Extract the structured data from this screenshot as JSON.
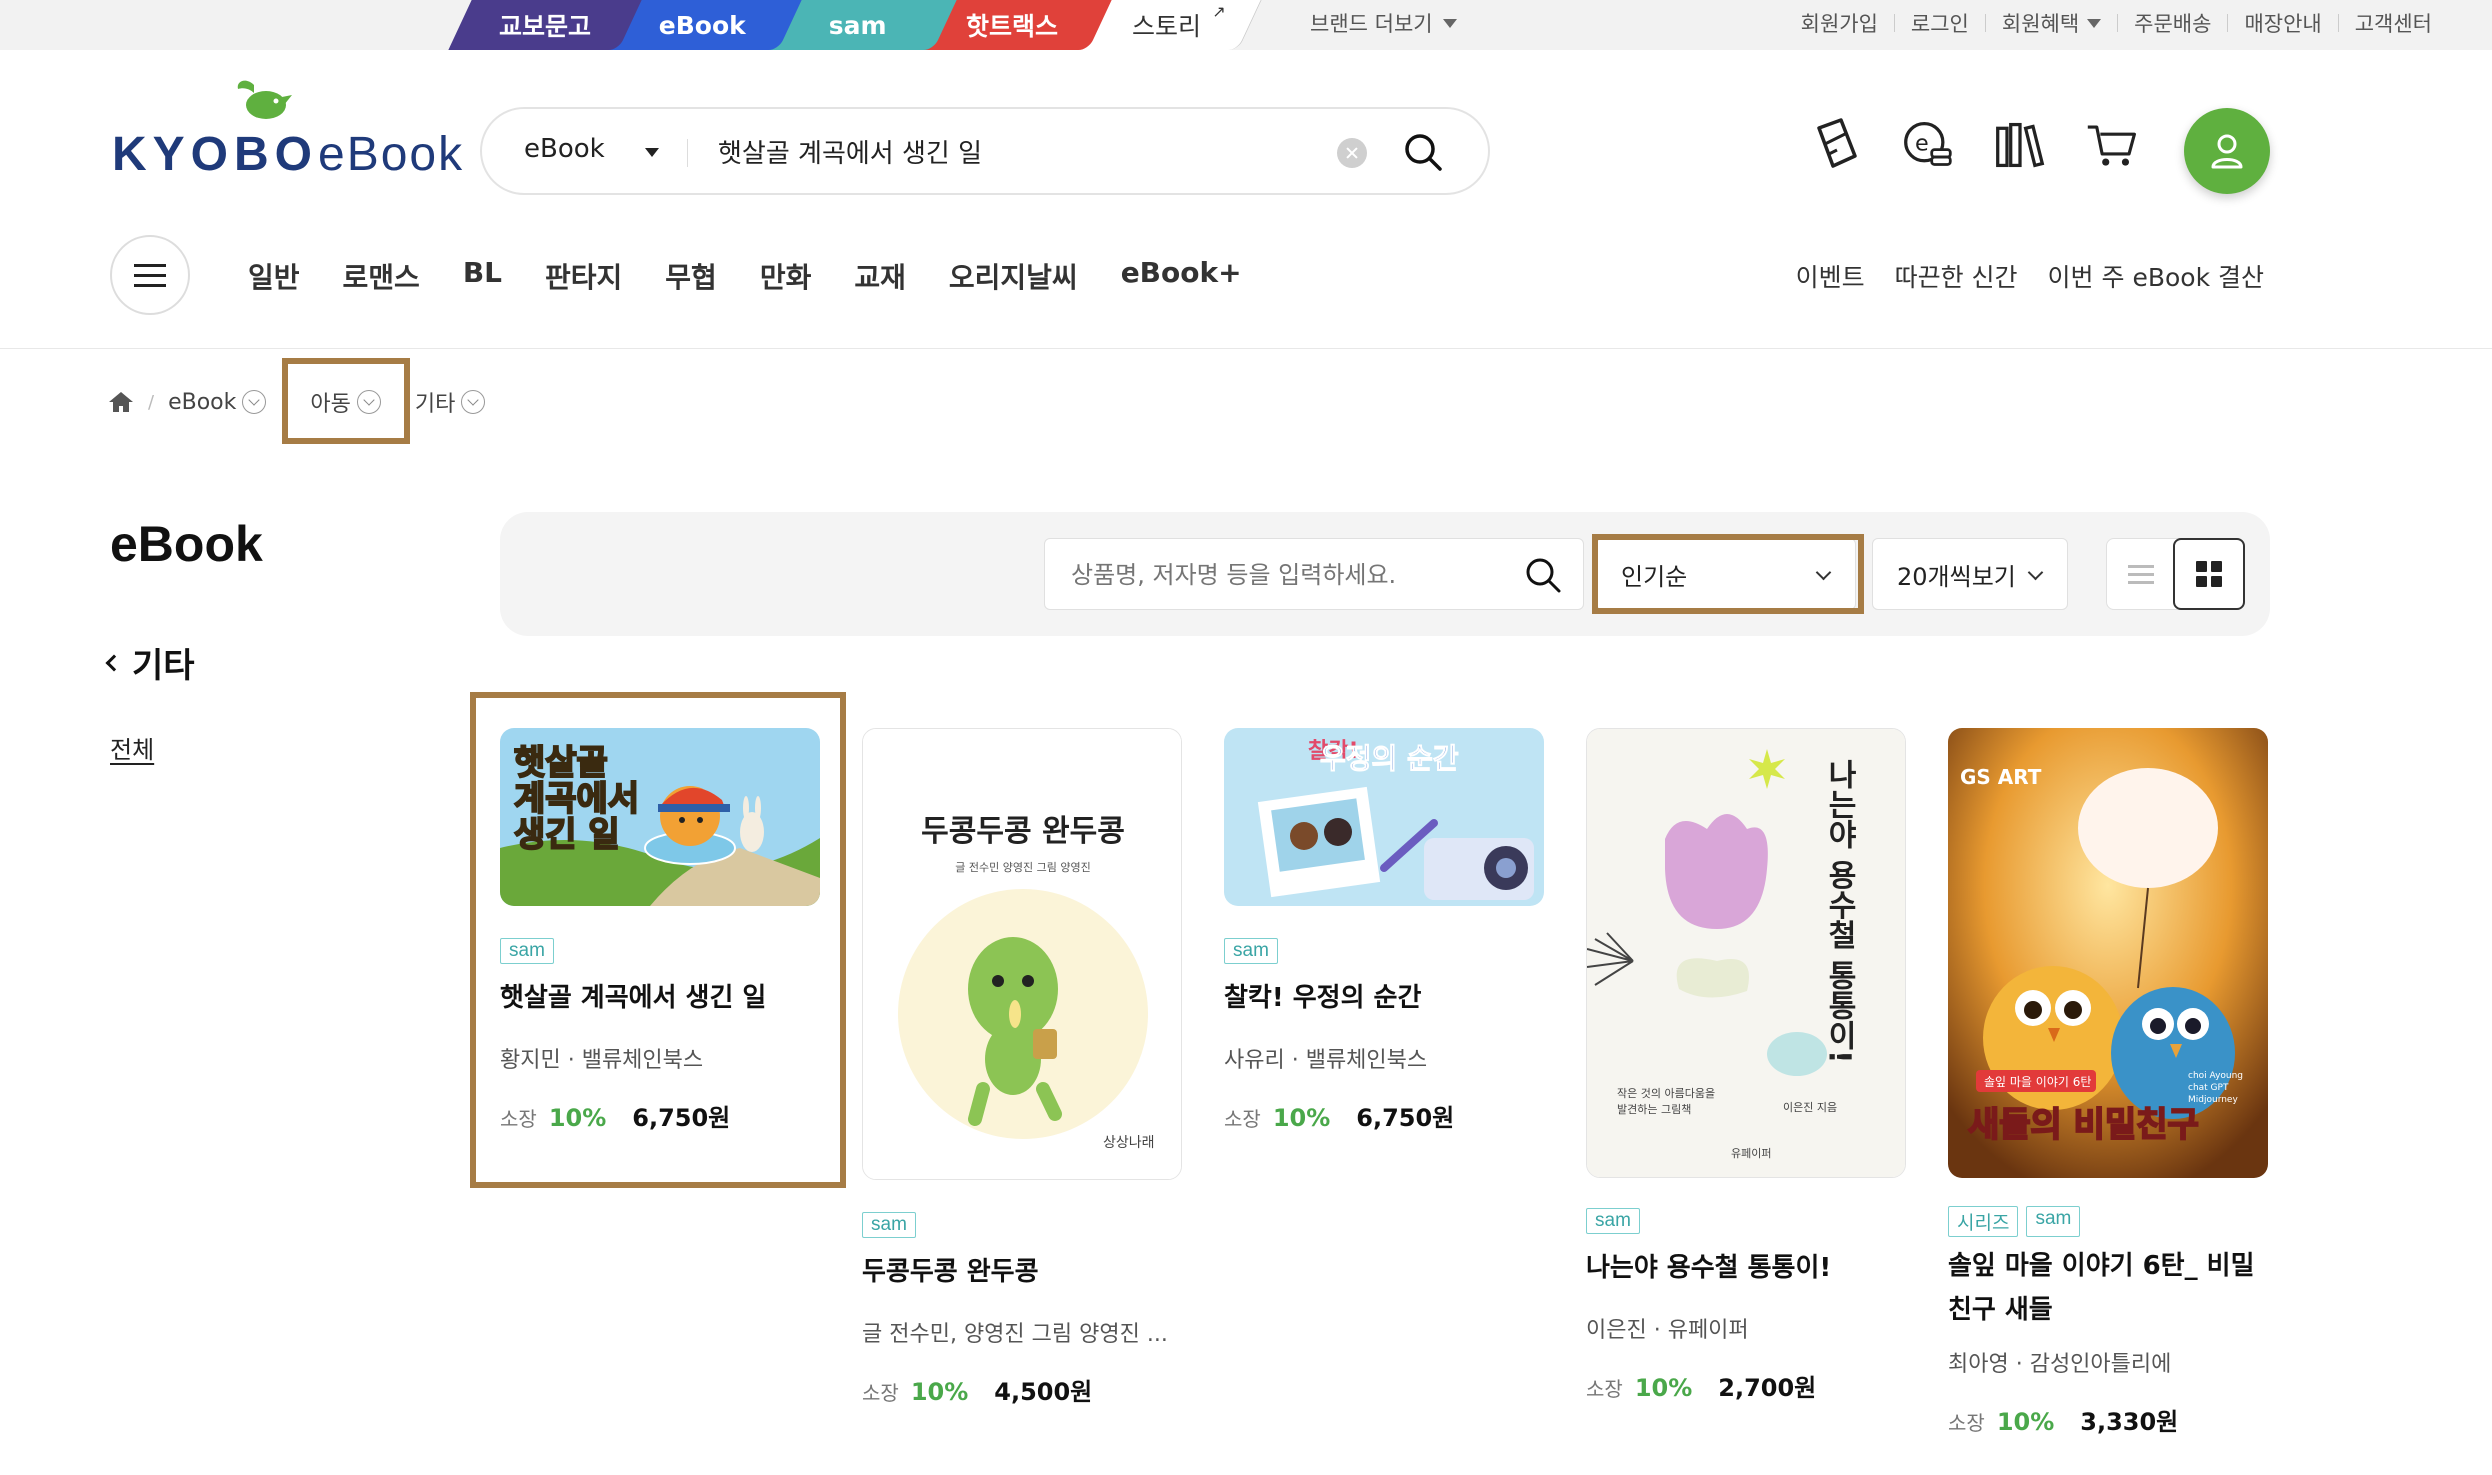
{
  "brand_tabs": [
    "교보문고",
    "eBook",
    "sam",
    "핫트랙스",
    "스토리"
  ],
  "brand_more": "브랜드 더보기",
  "util_links": [
    "회원가입",
    "로그인",
    "회원혜택",
    "주문배송",
    "매장안내",
    "고객센터"
  ],
  "logo": {
    "kyobo": "KYOBO",
    "ebook": "eBook"
  },
  "search": {
    "category": "eBook",
    "query": "햇살골 계곡에서 생긴 일"
  },
  "header_icons": [
    "ticket-icon",
    "ecash-icon",
    "library-icon",
    "cart-icon",
    "user-icon"
  ],
  "category_nav": [
    "일반",
    "로맨스",
    "BL",
    "판타지",
    "무협",
    "만화",
    "교재",
    "오리지날씨",
    "eBook+"
  ],
  "sub_nav": [
    "이벤트",
    "따끈한 신간",
    "이번 주 eBook 결산"
  ],
  "breadcrumb": {
    "level1": "eBook",
    "level2": "아동",
    "level3": "기타"
  },
  "sidebar": {
    "title": "eBook",
    "back_label": "기타",
    "all_link": "전체"
  },
  "filter": {
    "search_placeholder": "상품명, 저자명 등을 입력하세요.",
    "sort": "인기순",
    "count": "20개씩보기"
  },
  "products": [
    {
      "badges": [
        "sam"
      ],
      "title": "햇살골 계곡에서 생긴 일",
      "author": "황지민 · 밸류체인북스",
      "price_label": "소장",
      "discount": "10%",
      "price": "6,750원",
      "cover_text": [
        "햇살골",
        "계곡에서",
        "생긴 일"
      ]
    },
    {
      "badges": [
        "sam"
      ],
      "title": "두콩두콩 완두콩",
      "author": "글 전수민, 양영진 그림 양영진 ...",
      "price_label": "소장",
      "discount": "10%",
      "price": "4,500원",
      "cover_text": [
        "두콩두콩 완두콩",
        "글 전수민 양영진  그림 양영진",
        "상상나래"
      ]
    },
    {
      "badges": [
        "sam"
      ],
      "title": "찰칵! 우정의 순간",
      "author": "사유리 · 밸류체인북스",
      "price_label": "소장",
      "discount": "10%",
      "price": "6,750원",
      "cover_text": [
        "찰칵!",
        "우정의 순간"
      ]
    },
    {
      "badges": [
        "sam"
      ],
      "title": "나는야 용수철 통통이!",
      "author": "이은진 · 유페이퍼",
      "price_label": "소장",
      "discount": "10%",
      "price": "2,700원",
      "cover_text": [
        "나는야 용수철 통통이!",
        "작은 것의 아름다움을",
        "발견하는 그림책",
        "이은진 지음",
        "유페이퍼"
      ]
    },
    {
      "badges": [
        "시리즈",
        "sam"
      ],
      "title": "솔잎 마을 이야기 6탄_ 비밀 친구 새들",
      "author": "최아영 · 감성인아틀리에",
      "price_label": "소장",
      "discount": "10%",
      "price": "3,330원",
      "cover_text": [
        "GS ART",
        "솔잎 마을 이야기 6탄",
        "새들의 비밀친구",
        "choi Ayoung",
        "chat GPT",
        "Midjourney"
      ]
    }
  ],
  "colors": {
    "highlight": "#a67c45",
    "accent_green": "#5fb03f",
    "badge_teal": "#3aa5a5"
  }
}
